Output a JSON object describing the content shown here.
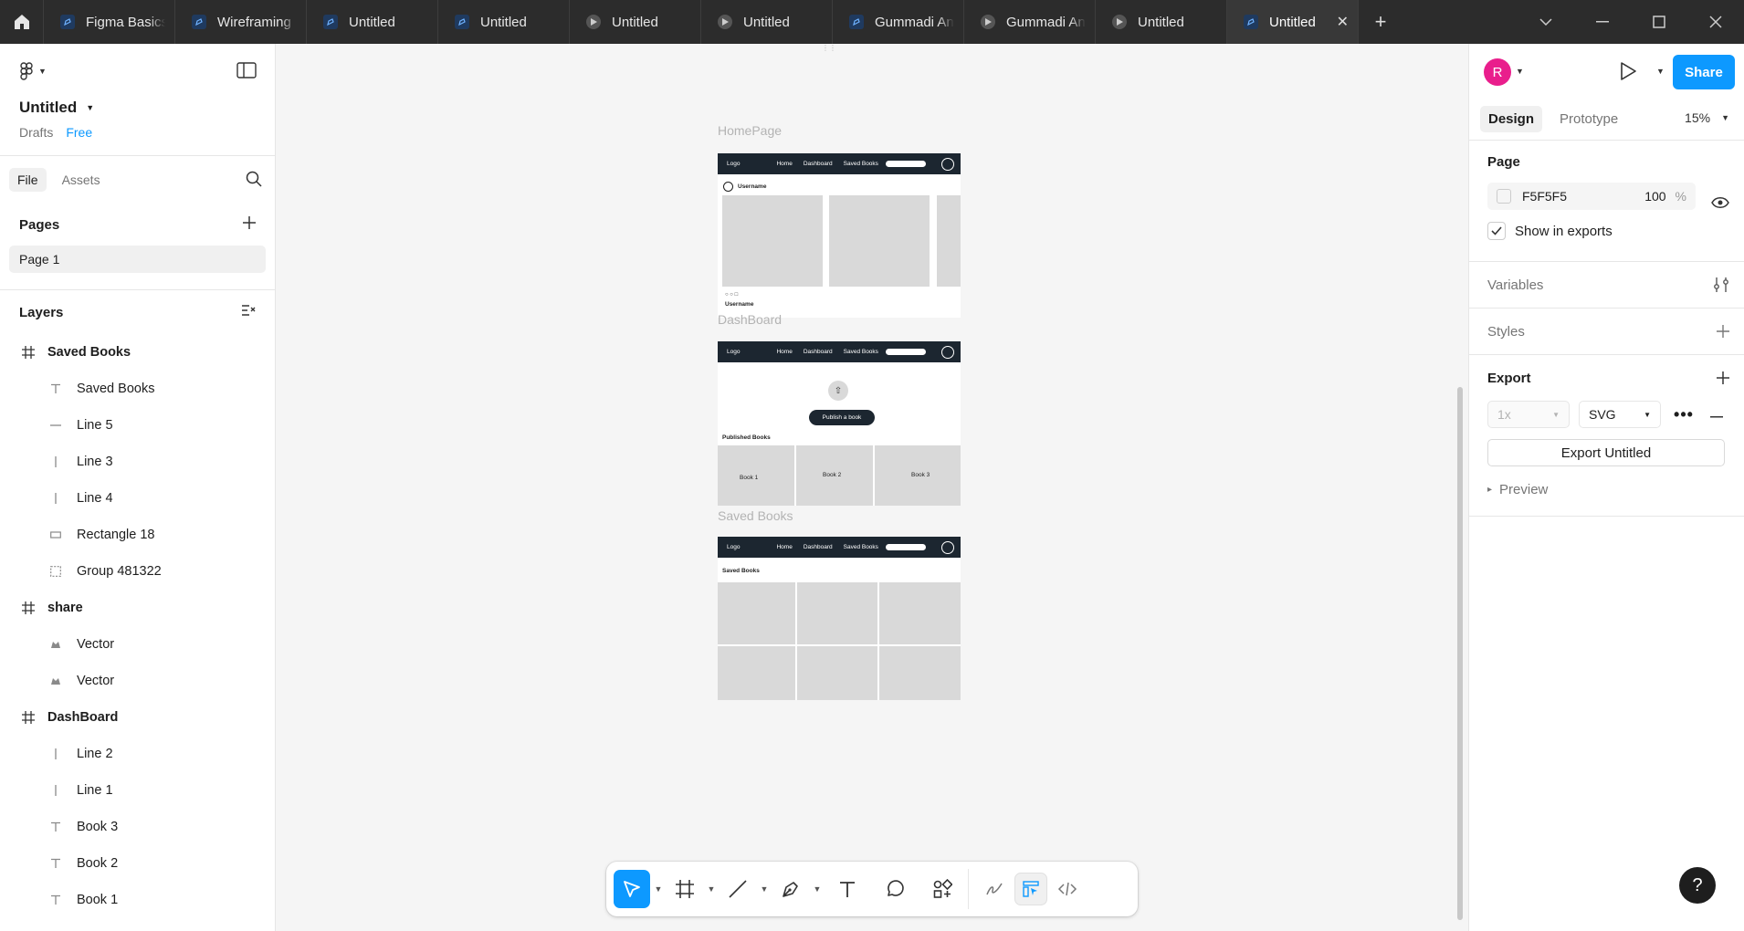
{
  "tabs": [
    {
      "label": "Figma Basics",
      "icon": "figma-file-icon",
      "active": false
    },
    {
      "label": "Wireframing",
      "icon": "figma-file-icon",
      "active": false
    },
    {
      "label": "Untitled",
      "icon": "figma-file-icon",
      "active": false
    },
    {
      "label": "Untitled",
      "icon": "figma-file-icon",
      "active": false
    },
    {
      "label": "Untitled",
      "icon": "prototype-play-icon",
      "active": false
    },
    {
      "label": "Untitled",
      "icon": "prototype-play-icon",
      "active": false
    },
    {
      "label": "Gummadi An",
      "icon": "figma-file-icon",
      "active": false
    },
    {
      "label": "Gummadi An",
      "icon": "prototype-play-icon",
      "active": false
    },
    {
      "label": "Untitled",
      "icon": "prototype-play-icon",
      "active": false
    },
    {
      "label": "Untitled",
      "icon": "figma-file-icon",
      "active": true
    }
  ],
  "file": {
    "title": "Untitled",
    "location": "Drafts",
    "plan": "Free"
  },
  "left_tabs": {
    "file": "File",
    "assets": "Assets"
  },
  "pages": {
    "heading": "Pages",
    "items": [
      "Page 1"
    ]
  },
  "layers": {
    "heading": "Layers",
    "items": [
      {
        "label": "Saved Books",
        "kind": "frame"
      },
      {
        "label": "Saved Books",
        "kind": "text"
      },
      {
        "label": "Line 5",
        "kind": "line"
      },
      {
        "label": "Line 3",
        "kind": "vline"
      },
      {
        "label": "Line 4",
        "kind": "vline"
      },
      {
        "label": "Rectangle 18",
        "kind": "rect"
      },
      {
        "label": "Group 481322",
        "kind": "group"
      },
      {
        "label": "share",
        "kind": "frame"
      },
      {
        "label": "Vector",
        "kind": "vector"
      },
      {
        "label": "Vector",
        "kind": "vector"
      },
      {
        "label": "DashBoard",
        "kind": "frame"
      },
      {
        "label": "Line 2",
        "kind": "vline"
      },
      {
        "label": "Line 1",
        "kind": "vline"
      },
      {
        "label": "Book 3",
        "kind": "text"
      },
      {
        "label": "Book 2",
        "kind": "text"
      },
      {
        "label": "Book 1",
        "kind": "text"
      }
    ]
  },
  "canvas": {
    "frames": {
      "homepage": {
        "label": "HomePage",
        "username_top": "Username",
        "username_bottom": "Username"
      },
      "dashboard": {
        "label": "DashBoard",
        "publish_btn": "Publish a book",
        "published_heading": "Published Books",
        "books": [
          "Book 1",
          "Book 2",
          "Book 3"
        ]
      },
      "saved": {
        "label": "Saved Books",
        "heading": "Saved Books"
      }
    },
    "nav": {
      "logo": "Logo",
      "links": [
        "Home",
        "Dashboard",
        "Saved Books"
      ]
    }
  },
  "right": {
    "avatar_initial": "R",
    "share_label": "Share",
    "tabs": {
      "design": "Design",
      "prototype": "Prototype"
    },
    "zoom": "15%",
    "page_section": {
      "title": "Page",
      "color_hex": "F5F5F5",
      "opacity": "100",
      "opacity_unit": "%",
      "show_in_exports": "Show in exports"
    },
    "variables": "Variables",
    "styles": "Styles",
    "export": {
      "title": "Export",
      "scale": "1x",
      "format": "SVG",
      "button": "Export Untitled",
      "preview": "Preview"
    }
  },
  "colors": {
    "accent": "#0d99ff",
    "tabbar": "#2c2c2c",
    "avatar": "#e91e8c",
    "nav_dark": "#1c2630",
    "placeholder": "#d9d9d9"
  }
}
